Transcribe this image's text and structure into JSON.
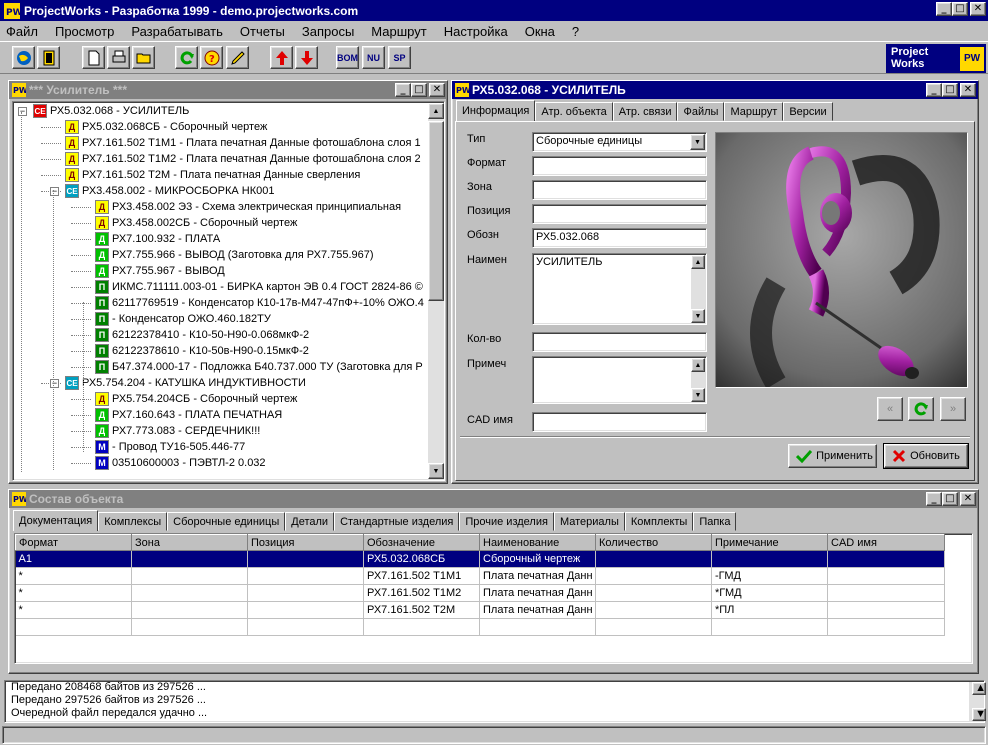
{
  "window": {
    "title": "ProjectWorks - Разработка 1999 - demo.projectworks.com"
  },
  "menu": [
    "Файл",
    "Просмотр",
    "Разрабатывать",
    "Отчеты",
    "Запросы",
    "Маршрут",
    "Настройка",
    "Окна",
    "?"
  ],
  "toolbar": {
    "text_buttons": [
      "BOM",
      "NU",
      "SP"
    ],
    "logo_line1": "Project",
    "logo_line2": "Works",
    "logo_badge": "PW"
  },
  "tree_panel": {
    "title": "*** Усилитель ***",
    "rows": [
      {
        "icon": "СЕ",
        "cls": "ic-se",
        "text": "РХ5.032.068 - УСИЛИТЕЛЬ",
        "indent": 0
      },
      {
        "icon": "Д",
        "cls": "ic-d",
        "text": "РХ5.032.068СБ - Сборочный чертеж",
        "indent": 1
      },
      {
        "icon": "Д",
        "cls": "ic-d",
        "text": "РХ7.161.502 Т1М1 - Плата печатная Данные фотошаблона слоя 1",
        "indent": 1
      },
      {
        "icon": "Д",
        "cls": "ic-d",
        "text": "РХ7.161.502 Т1М2 - Плата печатная Данные фотошаблона слоя 2",
        "indent": 1
      },
      {
        "icon": "Д",
        "cls": "ic-d",
        "text": "РХ7.161.502 Т2М - Плата печатная Данные сверления",
        "indent": 1
      },
      {
        "icon": "СЕ",
        "cls": "ic-cs",
        "text": "РХ3.458.002 - МИКРОСБОРКА НК001",
        "indent": 1
      },
      {
        "icon": "Д",
        "cls": "ic-d",
        "text": "РХ3.458.002 Э3 - Схема электрическая принципиальная",
        "indent": 2
      },
      {
        "icon": "Д",
        "cls": "ic-d",
        "text": "РХ3.458.002СБ - Сборочный чертеж",
        "indent": 2
      },
      {
        "icon": "Д",
        "cls": "ic-g",
        "text": "РХ7.100.932 - ПЛАТА",
        "indent": 2
      },
      {
        "icon": "Д",
        "cls": "ic-g",
        "text": "РХ7.755.966 - ВЫВОД (Заготовка для РХ7.755.967)",
        "indent": 2
      },
      {
        "icon": "Д",
        "cls": "ic-g",
        "text": "РХ7.755.967 - ВЫВОД",
        "indent": 2
      },
      {
        "icon": "П",
        "cls": "ic-gd",
        "text": "ИКМС.711111.003-01 - БИРКА картон ЭВ 0.4 ГОСТ 2824-86 ©",
        "indent": 2
      },
      {
        "icon": "П",
        "cls": "ic-gd",
        "text": "62117769519 - Конденсатор К10-17в-М47-47пФ+-10% ОЖО.4",
        "indent": 2
      },
      {
        "icon": "П",
        "cls": "ic-gd",
        "text": " - Конденсатор ОЖО.460.182ТУ",
        "indent": 2
      },
      {
        "icon": "П",
        "cls": "ic-gd",
        "text": "62122378410 - К10-50-Н90-0.068мкФ-2",
        "indent": 2
      },
      {
        "icon": "П",
        "cls": "ic-gd",
        "text": "62122378610 - К10-50в-Н90-0.15мкФ-2",
        "indent": 2
      },
      {
        "icon": "П",
        "cls": "ic-gd",
        "text": "Б47.374.000-17 - Подложка Б40.737.000 ТУ (Заготовка для Р",
        "indent": 2
      },
      {
        "icon": "СЕ",
        "cls": "ic-cs",
        "text": "РХ5.754.204 - КАТУШКА ИНДУКТИВНОСТИ",
        "indent": 1
      },
      {
        "icon": "Д",
        "cls": "ic-d",
        "text": "РХ5.754.204СБ - Сборочный чертеж",
        "indent": 2
      },
      {
        "icon": "Д",
        "cls": "ic-g",
        "text": "РХ7.160.643 - ПЛАТА ПЕЧАТНАЯ",
        "indent": 2
      },
      {
        "icon": "Д",
        "cls": "ic-g",
        "text": "РХ7.773.083 - СЕРДЕЧНИК!!!",
        "indent": 2
      },
      {
        "icon": "М",
        "cls": "ic-m",
        "text": " - Провод ТУ16-505.446-77",
        "indent": 2
      },
      {
        "icon": "М",
        "cls": "ic-m",
        "text": "03510600003 - ПЭВТЛ-2  0.032",
        "indent": 2
      }
    ]
  },
  "detail_panel": {
    "title": "РХ5.032.068 - УСИЛИТЕЛЬ",
    "tabs": [
      "Информация",
      "Атр. объекта",
      "Атр. связи",
      "Файлы",
      "Маршрут",
      "Версии"
    ],
    "labels": {
      "type": "Тип",
      "format": "Формат",
      "zone": "Зона",
      "position": "Позиция",
      "designation": "Обозн",
      "name": "Наимен",
      "qty": "Кол-во",
      "note": "Примеч",
      "cad": "CAD имя"
    },
    "values": {
      "type": "Сборочные единицы",
      "format": "",
      "zone": "",
      "position": "",
      "designation": "РХ5.032.068",
      "name": "УСИЛИТЕЛЬ",
      "qty": "",
      "note": "",
      "cad": ""
    },
    "apply_label": "Применить",
    "refresh_label": "Обновить"
  },
  "composition": {
    "title": "Состав объекта",
    "tabs": [
      "Документация",
      "Комплексы",
      "Сборочные единицы",
      "Детали",
      "Стандартные изделия",
      "Прочие изделия",
      "Материалы",
      "Комплекты",
      "Папка"
    ],
    "columns": [
      "Формат",
      "Зона",
      "Позиция",
      "Обозначение",
      "Наименование",
      "Количество",
      "Примечание",
      "CAD имя"
    ],
    "rows": [
      [
        "А1",
        "",
        "",
        "РХ5.032.068СБ",
        "Сборочный чертеж",
        "",
        "",
        ""
      ],
      [
        "*",
        "",
        "",
        "РХ7.161.502 Т1М1",
        "Плата печатная  Данн",
        "",
        "-ГМД",
        ""
      ],
      [
        "*",
        "",
        "",
        "РХ7.161.502 Т1М2",
        "Плата печатная  Данн",
        "",
        "*ГМД",
        ""
      ],
      [
        "*",
        "",
        "",
        "РХ7.161.502 Т2М",
        "Плата печатная  Данн",
        "",
        "*ПЛ",
        ""
      ],
      [
        "",
        "",
        "",
        "",
        "",
        "",
        "",
        ""
      ]
    ]
  },
  "log": [
    "Передано 208468 байтов из 297526 ...",
    "Передано 297526 байтов из 297526 ...",
    "Очередной файл передался удачно ..."
  ]
}
